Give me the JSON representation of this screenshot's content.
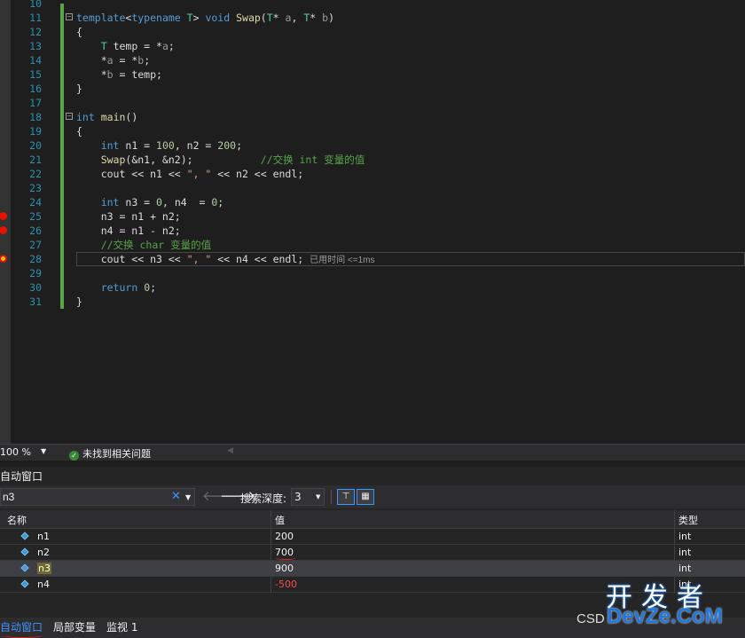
{
  "editor": {
    "lines": [
      {
        "num": "10",
        "html": ""
      },
      {
        "num": "11",
        "html": "<span class='kw'>template</span>&lt;<span class='kw'>typename</span> <span class='ty'>T</span>&gt; <span class='kw'>void</span> <span class='fn'>Swap</span>(<span class='ty'>T</span>* <span class='pm'>a</span>, <span class='ty'>T</span>* <span class='pm'>b</span>)",
        "fold": "−"
      },
      {
        "num": "12",
        "html": "{"
      },
      {
        "num": "13",
        "html": "    <span class='ty'>T</span> temp = *<span class='pm'>a</span>;"
      },
      {
        "num": "14",
        "html": "    *<span class='pm'>a</span> = *<span class='pm'>b</span>;"
      },
      {
        "num": "15",
        "html": "    *<span class='pm'>b</span> = temp;"
      },
      {
        "num": "16",
        "html": "}"
      },
      {
        "num": "17",
        "html": ""
      },
      {
        "num": "18",
        "html": "<span class='kw'>int</span> <span class='fn'>main</span>()",
        "fold": "−"
      },
      {
        "num": "19",
        "html": "{"
      },
      {
        "num": "20",
        "html": "    <span class='kw'>int</span> n1 = <span class='nm'>100</span>, n2 = <span class='nm'>200</span>;"
      },
      {
        "num": "21",
        "html": "    <span class='fn'>Swap</span>(&amp;n1, &amp;n2);           <span class='cm'>//交换 int 变量的值</span>"
      },
      {
        "num": "22",
        "html": "    cout &lt;&lt; n1 &lt;&lt; <span class='st'>\", \"</span> &lt;&lt; n2 &lt;&lt; endl;"
      },
      {
        "num": "23",
        "html": ""
      },
      {
        "num": "24",
        "html": "    <span class='kw'>int</span> n3 = <span class='nm'>0</span>, n4  = <span class='nm'>0</span>;"
      },
      {
        "num": "25",
        "html": "    n3 = n1 + n2;",
        "bp": "normal"
      },
      {
        "num": "26",
        "html": "    n4 = n1 - n2;",
        "bp": "normal"
      },
      {
        "num": "27",
        "html": "    <span class='cm'>//交换 char 变量的值</span>"
      },
      {
        "num": "28",
        "html": "    cout &lt;&lt; n3 &lt;&lt; <span class='st'>\", \"</span> &lt;&lt; n4 &lt;&lt; endl; <span class='elapsed'>已用时间 &lt;=1ms</span>",
        "bp": "current"
      },
      {
        "num": "29",
        "html": ""
      },
      {
        "num": "30",
        "html": "    <span class='kw'>return</span> <span class='nm'>0</span>;"
      },
      {
        "num": "31",
        "html": "}"
      }
    ]
  },
  "status": {
    "zoom": "100 %",
    "issues_text": "未找到相关问题"
  },
  "autos": {
    "title": "自动窗口",
    "search": {
      "value": "n3",
      "placeholder": ""
    },
    "depth_label": "搜索深度:",
    "depth_value": "3",
    "columns": {
      "name": "名称",
      "value": "值",
      "type": "类型"
    },
    "rows": [
      {
        "name": "n1",
        "value": "200",
        "type": "int",
        "changed": false,
        "selected": false
      },
      {
        "name": "n2",
        "value": "700",
        "type": "int",
        "changed": false,
        "selected": false
      },
      {
        "name": "n3",
        "value": "900",
        "type": "int",
        "changed": false,
        "selected": true
      },
      {
        "name": "n4",
        "value": "-500",
        "type": "int",
        "changed": true,
        "selected": false
      }
    ]
  },
  "tabs": [
    {
      "label": "自动窗口",
      "active": true
    },
    {
      "label": "局部变量",
      "active": false
    },
    {
      "label": "监视 1",
      "active": false
    }
  ],
  "watermark": {
    "csd": "CSD",
    "top": "开发者",
    "bottom": "DevZe.CoM"
  },
  "colors": {
    "accent": "#3e94ff",
    "changed_value": "#f14c4c",
    "breakpoint": "#e51400"
  }
}
